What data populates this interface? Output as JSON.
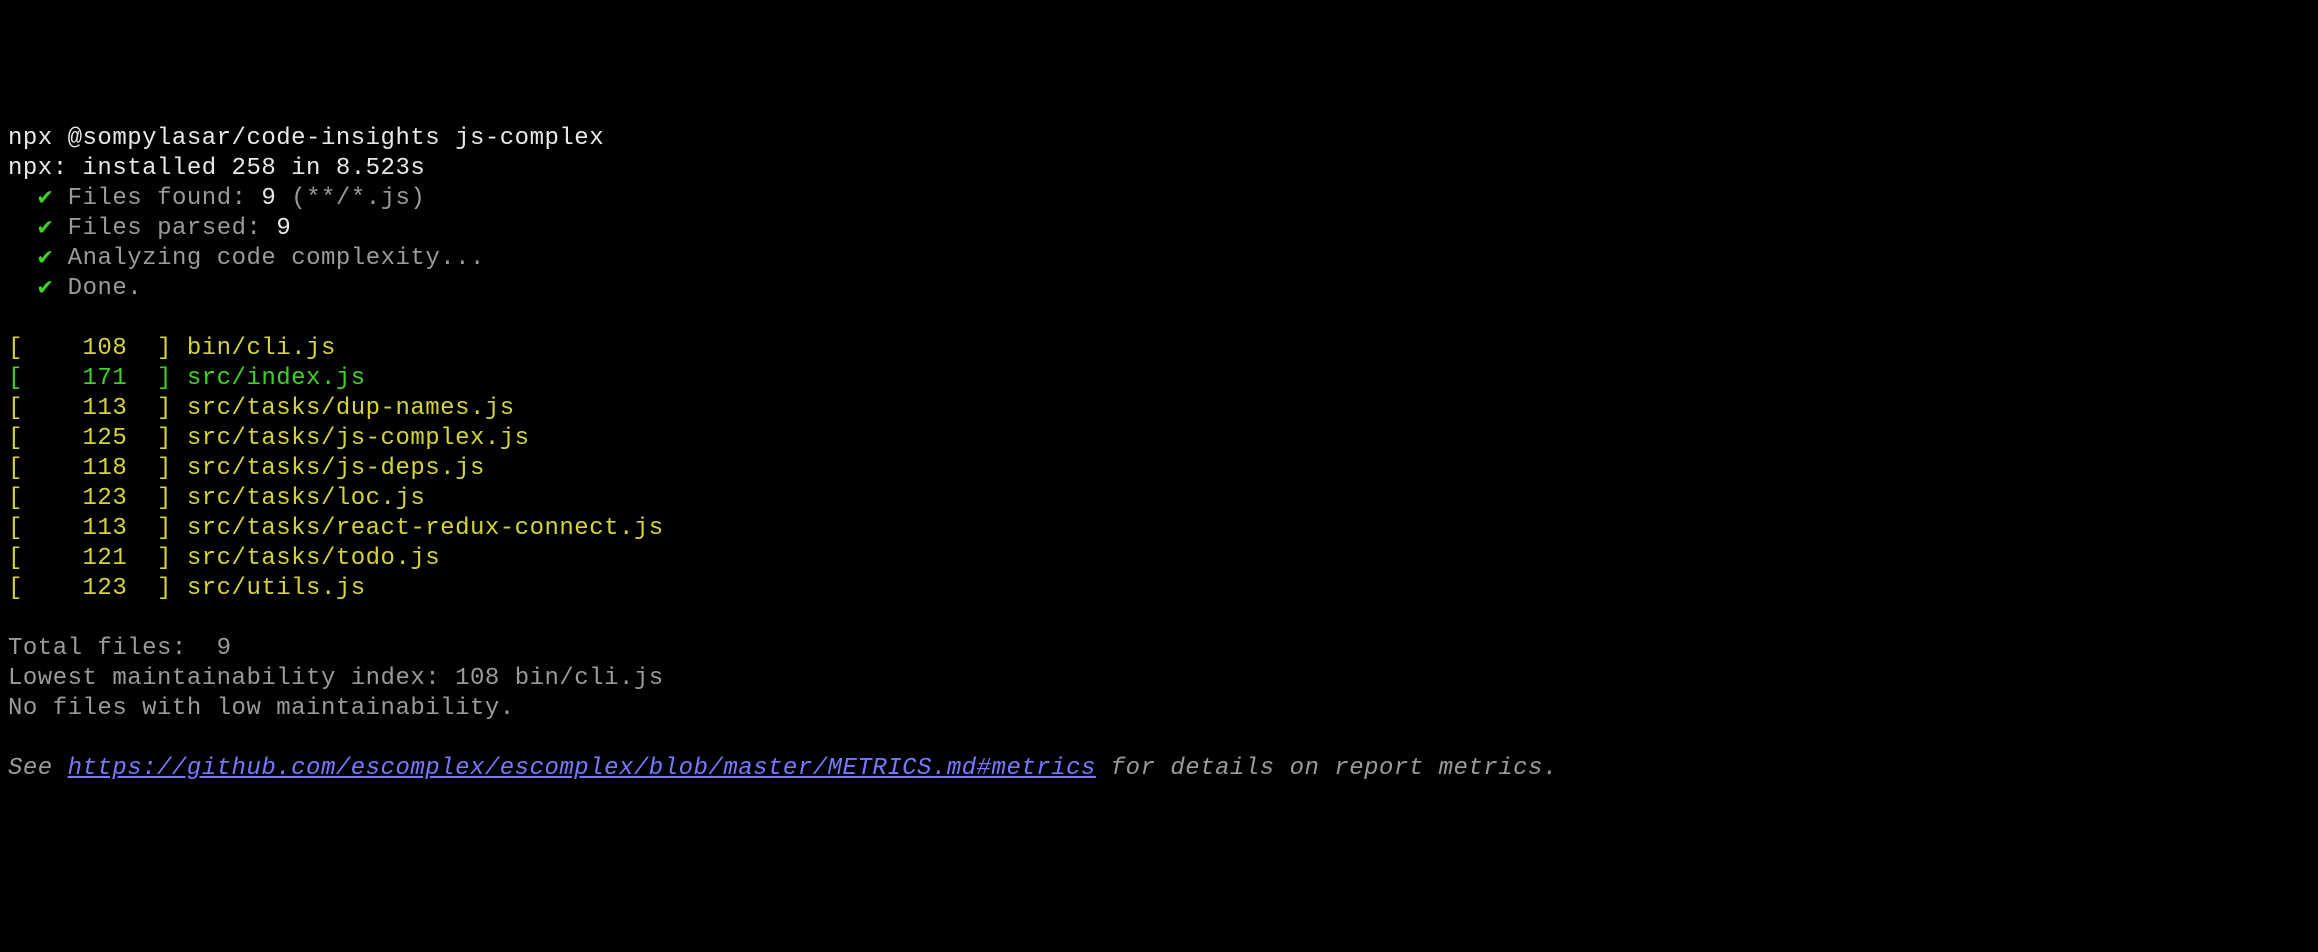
{
  "command": "npx @sompylasar/code-insights js-complex",
  "npx_install": "npx: installed 258 in 8.523s",
  "steps": {
    "files_found_label": "Files found: ",
    "files_found_count": "9",
    "files_found_pattern": " (**/*.js)",
    "files_parsed_label": "Files parsed: ",
    "files_parsed_count": "9",
    "analyzing": "Analyzing code complexity...",
    "done": "Done."
  },
  "rows": [
    {
      "val": "108",
      "path": "bin/cli.js",
      "hl": false
    },
    {
      "val": "171",
      "path": "src/index.js",
      "hl": true
    },
    {
      "val": "113",
      "path": "src/tasks/dup-names.js",
      "hl": false
    },
    {
      "val": "125",
      "path": "src/tasks/js-complex.js",
      "hl": false
    },
    {
      "val": "118",
      "path": "src/tasks/js-deps.js",
      "hl": false
    },
    {
      "val": "123",
      "path": "src/tasks/loc.js",
      "hl": false
    },
    {
      "val": "113",
      "path": "src/tasks/react-redux-connect.js",
      "hl": false
    },
    {
      "val": "121",
      "path": "src/tasks/todo.js",
      "hl": false
    },
    {
      "val": "123",
      "path": "src/utils.js",
      "hl": false
    }
  ],
  "summary": {
    "total_label": "Total files:  ",
    "total_value": "9",
    "lowest_label": "Lowest maintainability index: ",
    "lowest_value": "108 bin/cli.js",
    "no_low": "No files with low maintainability."
  },
  "footer": {
    "see": "See ",
    "url": "https://github.com/escomplex/escomplex/blob/master/METRICS.md#metrics",
    "tail": " for details on report metrics."
  },
  "check_glyph": "✔"
}
